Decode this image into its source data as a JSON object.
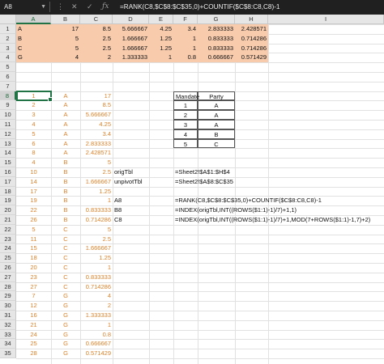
{
  "formula_bar": {
    "name_box": "A8",
    "formula": "=RANK(C8,$C$8:$C$35,0)+COUNTIF($C$8:C8,C8)-1",
    "icons": [
      "more-options-icon",
      "cancel-icon",
      "enter-icon",
      "fx-icon"
    ]
  },
  "columns": [
    "A",
    "B",
    "C",
    "D",
    "E",
    "F",
    "G",
    "H",
    "I"
  ],
  "rows": [
    "1",
    "2",
    "3",
    "4",
    "5",
    "6",
    "7",
    "8",
    "9",
    "10",
    "11",
    "12",
    "13",
    "14",
    "15",
    "16",
    "17",
    "18",
    "19",
    "20",
    "21",
    "22",
    "23",
    "24",
    "25",
    "26",
    "27",
    "28",
    "29",
    "30",
    "31",
    "32",
    "33",
    "34",
    "35"
  ],
  "top_table": [
    [
      "A",
      "17",
      "8.5",
      "5.666667",
      "4.25",
      "3.4",
      "2.833333",
      "2.428571"
    ],
    [
      "B",
      "5",
      "2.5",
      "1.666667",
      "1.25",
      "1",
      "0.833333",
      "0.714286"
    ],
    [
      "C",
      "5",
      "2.5",
      "1.666667",
      "1.25",
      "1",
      "0.833333",
      "0.714286"
    ],
    [
      "G",
      "4",
      "2",
      "1.333333",
      "1",
      "0.8",
      "0.666667",
      "0.571429"
    ]
  ],
  "unpivot": [
    [
      "1",
      "A",
      "17"
    ],
    [
      "2",
      "A",
      "8.5"
    ],
    [
      "3",
      "A",
      "5.666667"
    ],
    [
      "4",
      "A",
      "4.25"
    ],
    [
      "5",
      "A",
      "3.4"
    ],
    [
      "6",
      "A",
      "2.833333"
    ],
    [
      "8",
      "A",
      "2.428571"
    ],
    [
      "4",
      "B",
      "5"
    ],
    [
      "10",
      "B",
      "2.5"
    ],
    [
      "14",
      "B",
      "1.666667"
    ],
    [
      "17",
      "B",
      "1.25"
    ],
    [
      "19",
      "B",
      "1"
    ],
    [
      "22",
      "B",
      "0.833333"
    ],
    [
      "26",
      "B",
      "0.714286"
    ],
    [
      "5",
      "C",
      "5"
    ],
    [
      "11",
      "C",
      "2.5"
    ],
    [
      "15",
      "C",
      "1.666667"
    ],
    [
      "18",
      "C",
      "1.25"
    ],
    [
      "20",
      "C",
      "1"
    ],
    [
      "23",
      "C",
      "0.833333"
    ],
    [
      "27",
      "C",
      "0.714286"
    ],
    [
      "7",
      "G",
      "4"
    ],
    [
      "12",
      "G",
      "2"
    ],
    [
      "16",
      "G",
      "1.333333"
    ],
    [
      "21",
      "G",
      "1"
    ],
    [
      "24",
      "G",
      "0.8"
    ],
    [
      "25",
      "G",
      "0.666667"
    ],
    [
      "28",
      "G",
      "0.571429"
    ]
  ],
  "mandate_table": {
    "headers": [
      "Mandate",
      "Party"
    ],
    "rows": [
      [
        "1",
        "A"
      ],
      [
        "2",
        "A"
      ],
      [
        "3",
        "A"
      ],
      [
        "4",
        "B"
      ],
      [
        "5",
        "C"
      ]
    ]
  },
  "notes": [
    {
      "label": "origTbl",
      "value": "=Sheet2!$A$1:$H$4"
    },
    {
      "label": "unpivotTbl",
      "value": "=Sheet2!$A$8:$C$35"
    },
    {
      "label": "A8",
      "value": "=RANK(C8,$C$8:$C$35,0)+COUNTIF($C$8:C8,C8)-1"
    },
    {
      "label": "B8",
      "value": "=INDEX(origTbl,INT((ROWS($1:1)-1)/7)+1,1)"
    },
    {
      "label": "C8",
      "value": "=INDEX(origTbl,INT((ROWS($1:1)-1)/7)+1,MOD(7+ROWS($1:1)-1,7)+2)"
    }
  ],
  "colors": {
    "accent": "#217346",
    "orange_fill": "#f8cbad",
    "orange_text": "#d9822b"
  }
}
